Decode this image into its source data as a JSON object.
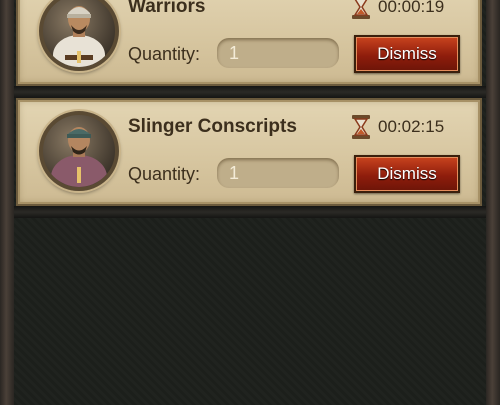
{
  "units": [
    {
      "name": "Warriors",
      "timer": "00:00:19",
      "quantity_label": "Quantity:",
      "quantity": "1",
      "dismiss_label": "Dismiss",
      "avatar": "warrior-portrait"
    },
    {
      "name": "Slinger Conscripts",
      "timer": "00:02:15",
      "quantity_label": "Quantity:",
      "quantity": "1",
      "dismiss_label": "Dismiss",
      "avatar": "slinger-portrait"
    }
  ],
  "icons": {
    "timer": "hourglass-icon"
  },
  "colors": {
    "dismiss": "#a12a12",
    "card": "#dccca8",
    "background": "#1d1f1c"
  }
}
